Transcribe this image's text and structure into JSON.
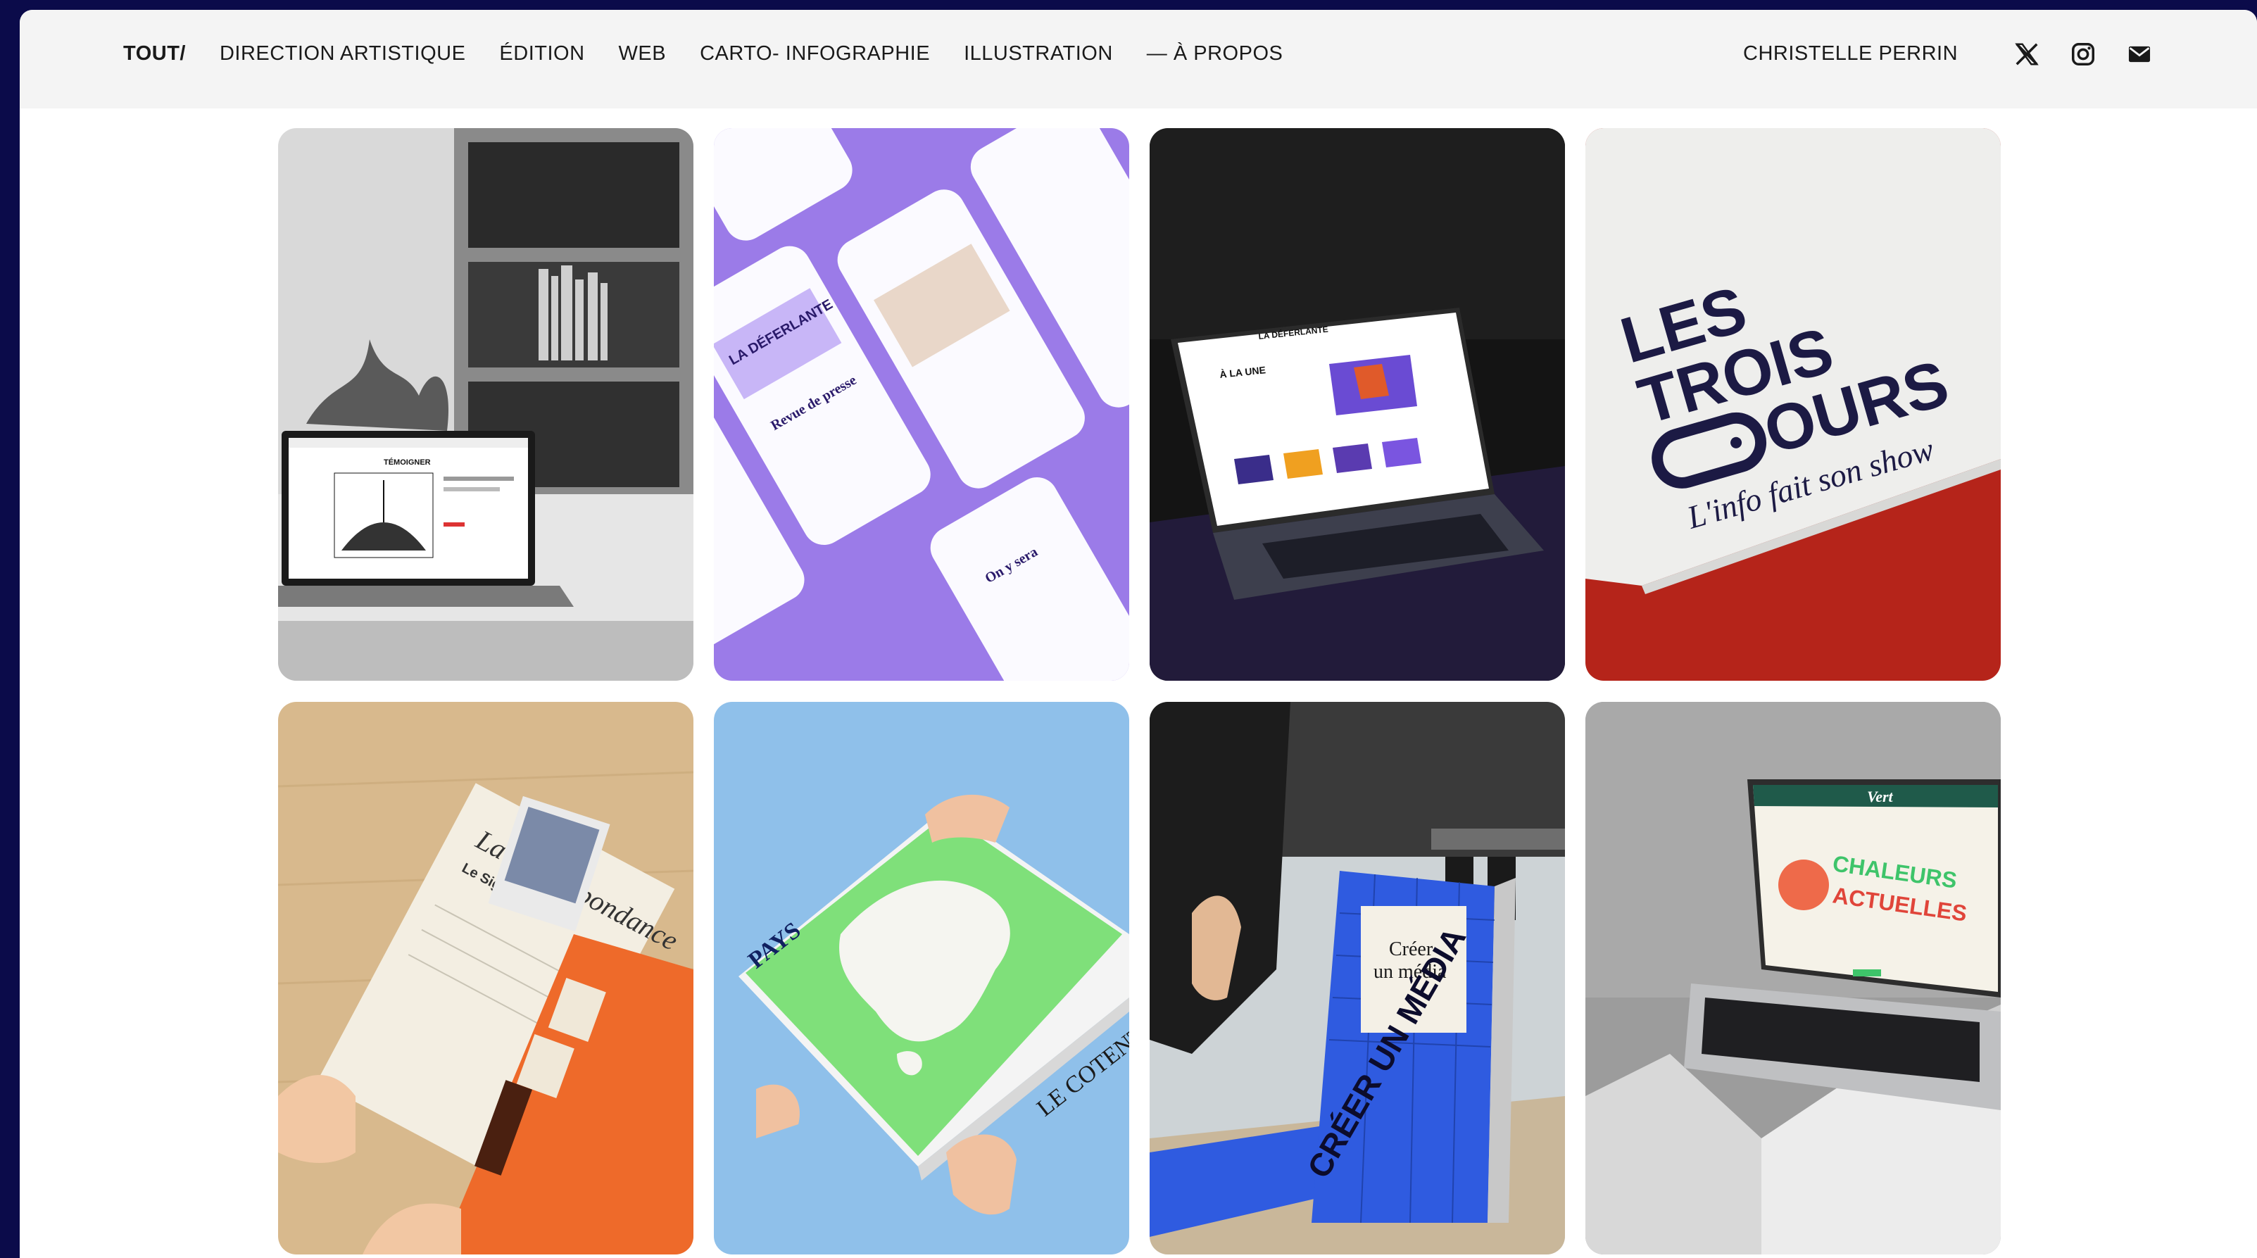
{
  "nav": {
    "items": [
      {
        "label": "TOUT/",
        "active": true
      },
      {
        "label": "DIRECTION ARTISTIQUE"
      },
      {
        "label": "ÉDITION"
      },
      {
        "label": "WEB"
      },
      {
        "label": "CARTO- INFOGRAPHIE"
      },
      {
        "label": "ILLUSTRATION"
      },
      {
        "label": "— À PROPOS"
      }
    ],
    "owner": "CHRISTELLE PERRIN",
    "social_icons": [
      "x-icon",
      "instagram-icon",
      "mail-icon"
    ]
  },
  "projects": [
    {
      "name": "laptop-bw-bookshelf",
      "screen_title": "TÉMOIGNER"
    },
    {
      "name": "phones-purple",
      "brand": "LA DÉFERLANTE",
      "texts": [
        "Revue de presse",
        "On y sera"
      ]
    },
    {
      "name": "laptop-dark",
      "brand": "LA DÉFERLANTE",
      "texts": [
        "À LA UNE"
      ]
    },
    {
      "name": "les-trois-ours",
      "logo_lines": [
        "LES",
        "TROIS",
        "OURS"
      ],
      "tagline": "L'info fait son show"
    },
    {
      "name": "envelope-correspondance",
      "texts": [
        "La Correspondance",
        "Le Signal"
      ]
    },
    {
      "name": "map-book",
      "texts": [
        "PAYS",
        "LE COTENTIN"
      ]
    },
    {
      "name": "book-creer-un-media",
      "texts": [
        "Créer",
        "un média",
        "CRÉER UN MÉDIA"
      ]
    },
    {
      "name": "laptop-vert",
      "brand": "Vert",
      "texts": [
        "CHALEURS",
        "ACTUELLES"
      ]
    }
  ],
  "colors": {
    "frame": "#0b0b4a",
    "topbar": "#f4f4f4",
    "purple": "#9b7be8",
    "red": "#c0261a",
    "orange": "#f06a2a",
    "green": "#7fe07a",
    "blue": "#2f5be0",
    "sky": "#8fc0ea"
  }
}
